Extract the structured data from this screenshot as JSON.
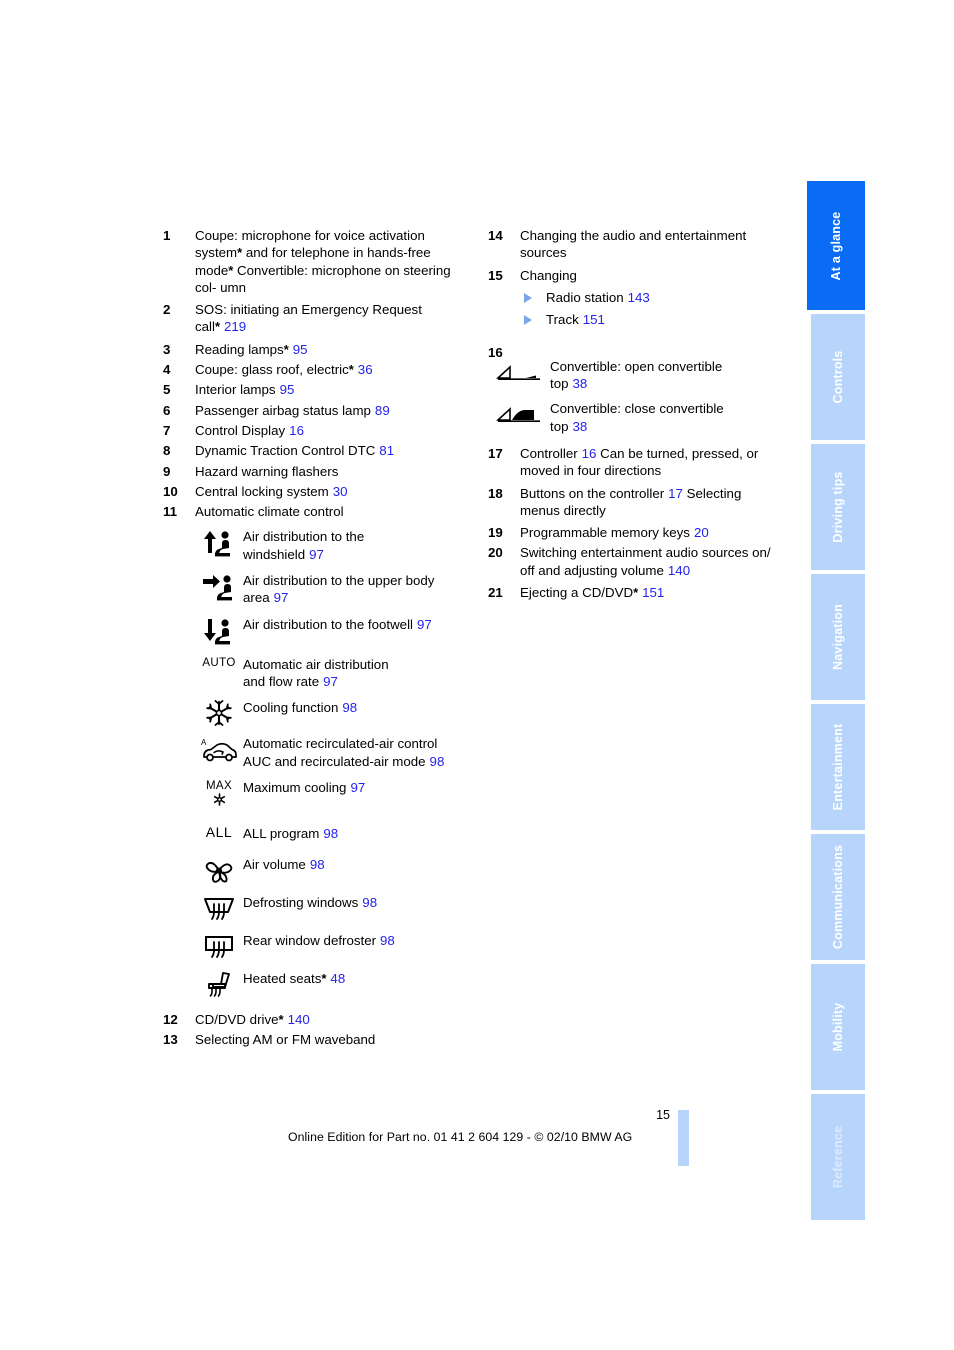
{
  "page": {
    "number": "15",
    "footer": "Online Edition for Part no. 01 41 2 604 129 - © 02/10 BMW AG"
  },
  "tabs": [
    {
      "label": "At a glance",
      "active": true
    },
    {
      "label": "Controls",
      "active": false
    },
    {
      "label": "Driving tips",
      "active": false
    },
    {
      "label": "Navigation",
      "active": false
    },
    {
      "label": "Entertainment",
      "active": false
    },
    {
      "label": "Communications",
      "active": false
    },
    {
      "label": "Mobility",
      "active": false
    },
    {
      "label": "Reference",
      "active": false
    }
  ],
  "colors": {
    "tab_active": "#0a6cf5",
    "tab_inactive": "#b7d4fb",
    "page_reference": "#2222ee",
    "bullet_triangle": "#7ba7e8"
  },
  "left_column": {
    "item1": {
      "num": "1",
      "line1": "Coupe: microphone for voice activation",
      "line2_a": "system",
      "line2_b": " and for telephone in hands-free",
      "line3": "mode",
      "line4": "Convertible: microphone on steering col-",
      "line5": "umn"
    },
    "item2": {
      "num": "2",
      "line1": "SOS: initiating an Emergency Request",
      "line2": "call",
      "page": "219"
    },
    "item3": {
      "num": "3",
      "label": "Reading lamps",
      "page": "95"
    },
    "item4": {
      "num": "4",
      "label": "Coupe: glass roof, electric",
      "page": "36"
    },
    "item5": {
      "num": "5",
      "label": "Interior lamps",
      "page": "95"
    },
    "item6": {
      "num": "6",
      "label": "Passenger airbag status lamp",
      "page": "89"
    },
    "item7": {
      "num": "7",
      "label": "Control Display",
      "page": "16"
    },
    "item8": {
      "num": "8",
      "label": "Dynamic Traction Control DTC",
      "page": "81"
    },
    "item9": {
      "num": "9",
      "label": "Hazard warning flashers",
      "page": ""
    },
    "item10": {
      "num": "10",
      "label": "Central locking system",
      "page": "30"
    },
    "item11": {
      "num": "11",
      "label": "Automatic climate control"
    },
    "climate_icons": [
      {
        "icon": "air-distribution-windshield-icon",
        "line1": "Air distribution to the",
        "line2": "windshield",
        "page": "97"
      },
      {
        "icon": "air-distribution-upper-body-icon",
        "line1": "Air distribution to the upper body",
        "line2": "area",
        "page": "97"
      },
      {
        "icon": "air-distribution-footwell-icon",
        "line1": "Air distribution to the footwell",
        "line2": "",
        "page": "97"
      },
      {
        "icon": "auto-text-icon",
        "icon_text": "AUTO",
        "line1": "Automatic air distribution",
        "line2": "and flow rate",
        "page": "97"
      },
      {
        "icon": "snowflake-icon",
        "line1": "Cooling function",
        "line2": "",
        "page": "98"
      },
      {
        "icon": "recirculated-air-car-icon",
        "line1": "Automatic recirculated-air control",
        "line2": "AUC and recirculated-air mode",
        "page": "98"
      },
      {
        "icon": "max-cooling-icon",
        "icon_text": "MAX",
        "line1": "Maximum cooling",
        "line2": "",
        "page": "97"
      },
      {
        "icon": "all-text-icon",
        "icon_text": "ALL",
        "line1": "ALL program",
        "line2": "",
        "page": "98"
      },
      {
        "icon": "fan-icon",
        "line1": "Air volume",
        "line2": "",
        "page": "98"
      },
      {
        "icon": "defrost-windshield-icon",
        "line1": "Defrosting windows",
        "line2": "",
        "page": "98"
      },
      {
        "icon": "rear-window-defroster-icon",
        "line1": "Rear window defroster",
        "line2": "",
        "page": "98"
      },
      {
        "icon": "heated-seat-icon",
        "line1": "Heated seats",
        "line2": "",
        "page": "48",
        "starred": true
      }
    ],
    "item12": {
      "num": "12",
      "label": "CD/DVD drive",
      "page": "140"
    },
    "item13": {
      "num": "13",
      "label": "Selecting AM or FM waveband",
      "page": ""
    }
  },
  "right_column": {
    "item14": {
      "num": "14",
      "line1": "Changing the audio and entertainment",
      "line2": "sources"
    },
    "item15": {
      "num": "15",
      "label": "Changing",
      "subitems": [
        {
          "label": "Radio station",
          "page": "143"
        },
        {
          "label": "Track",
          "page": "151"
        }
      ]
    },
    "item16": {
      "num": "16",
      "rows": [
        {
          "icon": "convertible-top-open-icon",
          "line1": "Convertible: open convertible",
          "line2": "top",
          "page": "38"
        },
        {
          "icon": "convertible-top-close-icon",
          "line1": "Convertible: close convertible",
          "line2": "top",
          "page": "38"
        }
      ]
    },
    "item17": {
      "num": "17",
      "label": "Controller",
      "page": "16",
      "line2": "Can be turned, pressed, or moved in four",
      "line3": "directions"
    },
    "item18": {
      "num": "18",
      "label": "Buttons on the controller",
      "page": "17",
      "line2": "Selecting menus directly"
    },
    "item19": {
      "num": "19",
      "label": "Programmable memory keys",
      "page": "20"
    },
    "item20": {
      "num": "20",
      "line1": "Switching entertainment audio sources on/",
      "line2": "off and adjusting volume",
      "page": "140"
    },
    "item21": {
      "num": "21",
      "label": "Ejecting a CD/DVD",
      "page": "151"
    }
  }
}
